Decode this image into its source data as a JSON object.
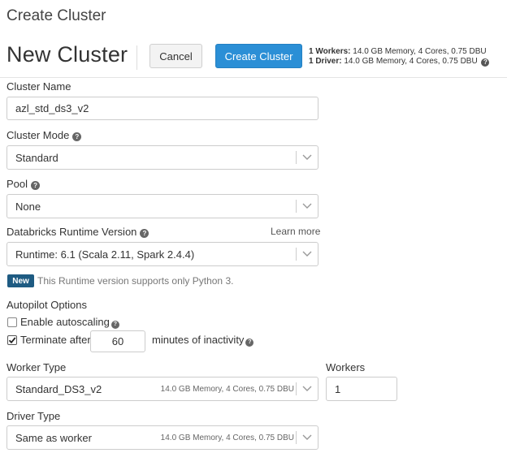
{
  "page": {
    "header": "Create Cluster"
  },
  "title_row": {
    "cluster_title": "New Cluster",
    "cancel_label": "Cancel",
    "create_label": "Create Cluster",
    "workers_summary_label": "1 Workers:",
    "workers_summary_value": "14.0 GB Memory, 4 Cores, 0.75 DBU",
    "driver_summary_label": "1 Driver:",
    "driver_summary_value": "14.0 GB Memory, 4 Cores, 0.75 DBU"
  },
  "form": {
    "cluster_name": {
      "label": "Cluster Name",
      "value": "azl_std_ds3_v2"
    },
    "cluster_mode": {
      "label": "Cluster Mode",
      "value": "Standard"
    },
    "pool": {
      "label": "Pool",
      "value": "None"
    },
    "runtime": {
      "label": "Databricks Runtime Version",
      "learn_more": "Learn more",
      "value": "Runtime: 6.1 (Scala 2.11, Spark 2.4.4)",
      "badge": "New",
      "note": "This Runtime version supports only Python 3."
    },
    "autopilot": {
      "label": "Autopilot Options",
      "autoscaling_label": "Enable autoscaling",
      "autoscaling_checked": false,
      "terminate_label": "Terminate after",
      "terminate_checked": true,
      "terminate_minutes": "60",
      "terminate_suffix": "minutes of inactivity"
    },
    "worker_type": {
      "label": "Worker Type",
      "value": "Standard_DS3_v2",
      "hint": "14.0 GB Memory, 4 Cores, 0.75 DBU"
    },
    "workers": {
      "label": "Workers",
      "value": "1"
    },
    "driver_type": {
      "label": "Driver Type",
      "value": "Same as worker",
      "hint": "14.0 GB Memory, 4 Cores, 0.75 DBU"
    }
  },
  "colors": {
    "primary_button": "#2b8fd6",
    "new_badge": "#1e5b82"
  },
  "icons": {
    "help": "question-circle-icon",
    "dropdown": "chevron-down-icon",
    "check": "checkmark-icon"
  }
}
